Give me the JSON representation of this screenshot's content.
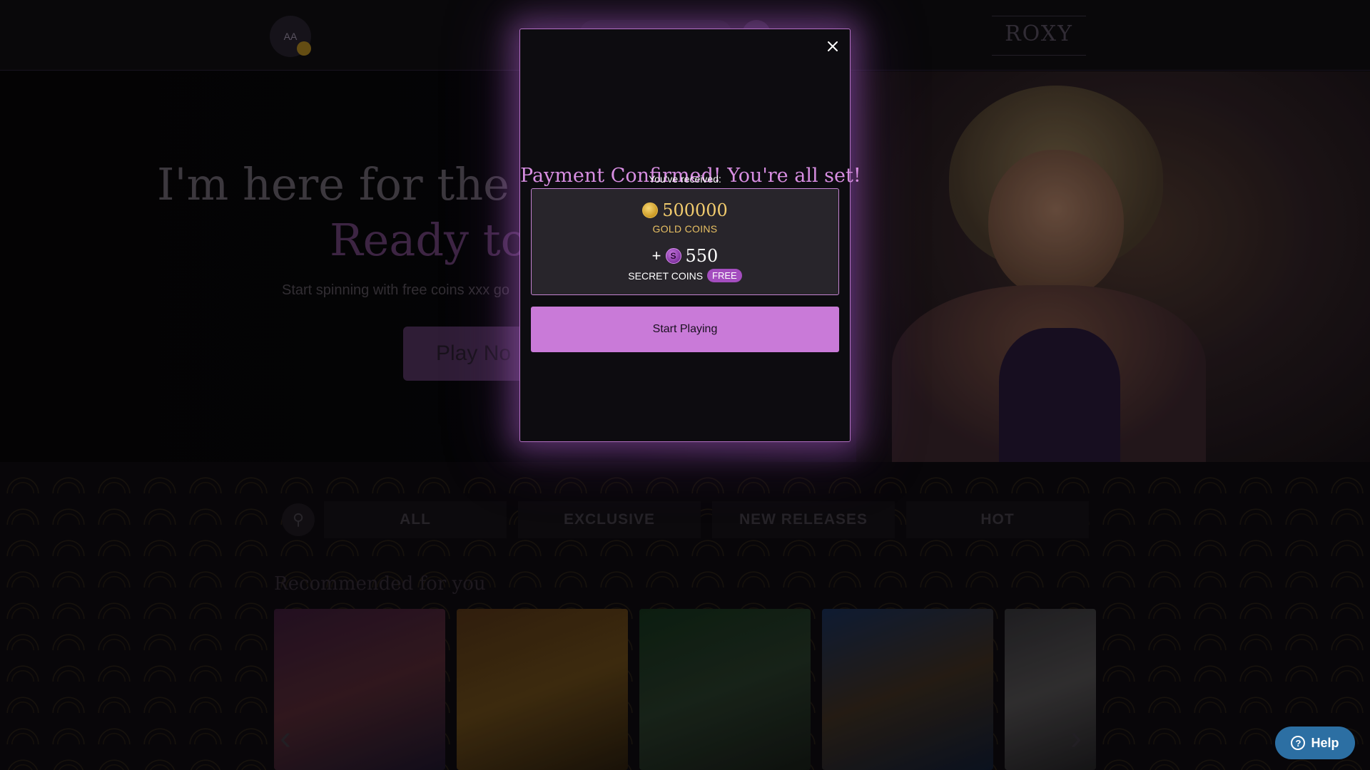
{
  "background": {
    "avatar_initials": "AA",
    "logo_text": "ROXY",
    "hero": {
      "title_line1": "I'm here for the g",
      "title_line2": "Ready to",
      "subtitle": "Start spinning with free coins xxx go",
      "play_button": "Play No"
    },
    "categories": [
      "ALL",
      "EXCLUSIVE",
      "NEW RELEASES",
      "HOT"
    ],
    "recommended_title": "Recommended for you",
    "help_label": "Help"
  },
  "modal": {
    "title": "Payment Confirmed! You're all set!",
    "received_label": "You've received:",
    "gold": {
      "amount": "500000",
      "label": "GOLD COINS"
    },
    "secret": {
      "plus": "+",
      "amount": "550",
      "label": "SECRET COINS",
      "badge": "FREE",
      "coin_symbol": "S"
    },
    "start_button": "Start Playing",
    "close_icon": "close-icon"
  },
  "colors": {
    "accent": "#c97ad8",
    "title": "#d88ee2",
    "gold": "#f2cc6e",
    "help": "#2c6fa3"
  }
}
